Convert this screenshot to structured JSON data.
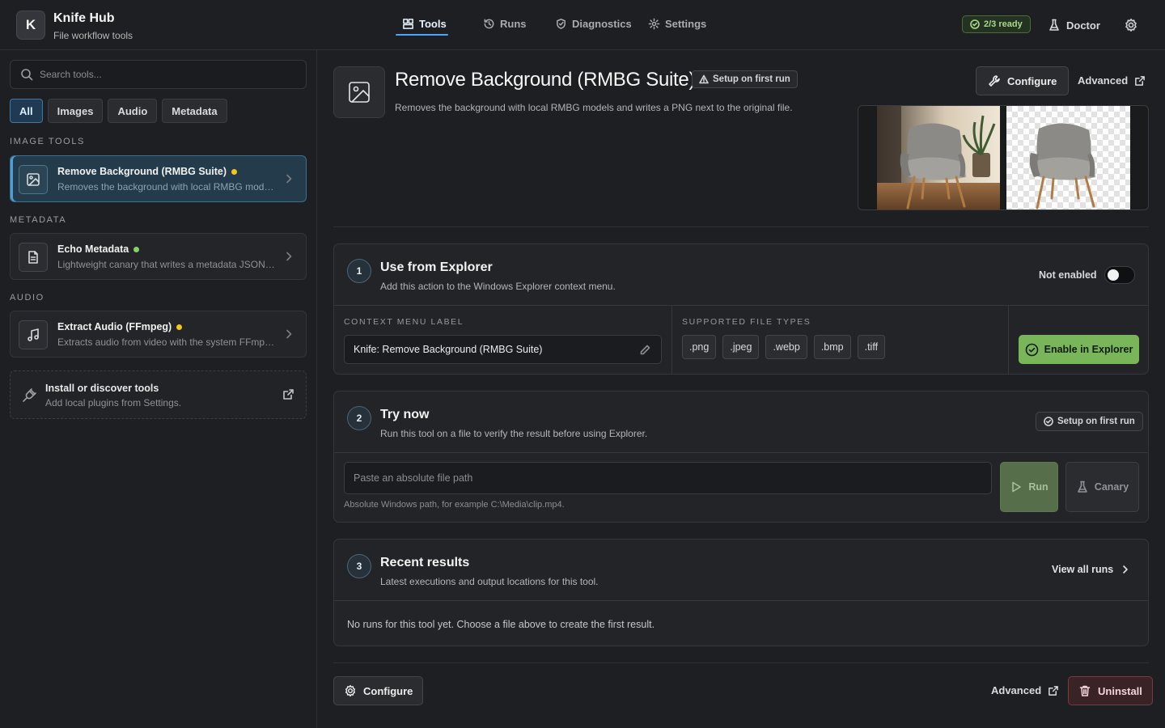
{
  "app": {
    "logo_letter": "K",
    "title": "Knife Hub",
    "subtitle": "File workflow tools"
  },
  "nav": {
    "tools": "Tools",
    "runs": "Runs",
    "diagnostics": "Diagnostics",
    "settings": "Settings",
    "active": "Tools"
  },
  "header": {
    "ready_badge": "2/3 ready",
    "doctor": "Doctor"
  },
  "sidebar": {
    "search_placeholder": "Search tools...",
    "filters": [
      "All",
      "Images",
      "Audio",
      "Metadata"
    ],
    "active_filter": "All",
    "sections": {
      "image_tools": "IMAGE TOOLS",
      "metadata": "METADATA",
      "audio": "AUDIO"
    },
    "tools": [
      {
        "name": "Remove Background (RMBG Suite)",
        "desc": "Removes the background with local RMBG models and writes a PNG next to the original file.",
        "status_color": "#f5c518",
        "selected": true
      },
      {
        "name": "Echo Metadata",
        "desc": "Lightweight canary that writes a metadata JSON file next to the original.",
        "status_color": "#86d466",
        "selected": false
      },
      {
        "name": "Extract Audio (FFmpeg)",
        "desc": "Extracts audio from video with the system FFmpeg install.",
        "status_color": "#f5c518",
        "selected": false
      }
    ],
    "install": {
      "title": "Install or discover tools",
      "subtitle": "Add local plugins from Settings."
    }
  },
  "main": {
    "title": "Remove Background (RMBG Suite)",
    "setup_badge": "Setup on first run",
    "description": "Removes the background with local RMBG models and writes a PNG next to the original file.",
    "configure": "Configure",
    "advanced": "Advanced"
  },
  "explorer_panel": {
    "step": "1",
    "title": "Use from Explorer",
    "subtitle": "Add this action to the Windows Explorer context menu.",
    "toggle_label": "Not enabled",
    "toggle_on": false,
    "context_label_heading": "CONTEXT MENU LABEL",
    "context_label_value": "Knife: Remove Background (RMBG Suite)",
    "file_types_heading": "SUPPORTED FILE TYPES",
    "file_types": [
      ".png",
      ".jpeg",
      ".webp",
      ".bmp",
      ".tiff"
    ],
    "enable_button": "Enable in Explorer"
  },
  "try_panel": {
    "step": "2",
    "title": "Try now",
    "subtitle": "Run this tool on a file to verify the result before using Explorer.",
    "setup_pill": "Setup on first run",
    "path_placeholder": "Paste an absolute file path",
    "hint": "Absolute Windows path, for example C:\\Media\\clip.mp4.",
    "run": "Run",
    "canary": "Canary"
  },
  "results_panel": {
    "step": "3",
    "title": "Recent results",
    "subtitle": "Latest executions and output locations for this tool.",
    "view_all": "View all runs",
    "empty": "No runs for this tool yet. Choose a file above to create the first result."
  },
  "footer": {
    "configure": "Configure",
    "advanced": "Advanced",
    "uninstall": "Uninstall"
  },
  "colors": {
    "accent": "#4da3ff",
    "success": "#79b65a",
    "warning": "#f5c518",
    "danger": "#7a3a42"
  }
}
